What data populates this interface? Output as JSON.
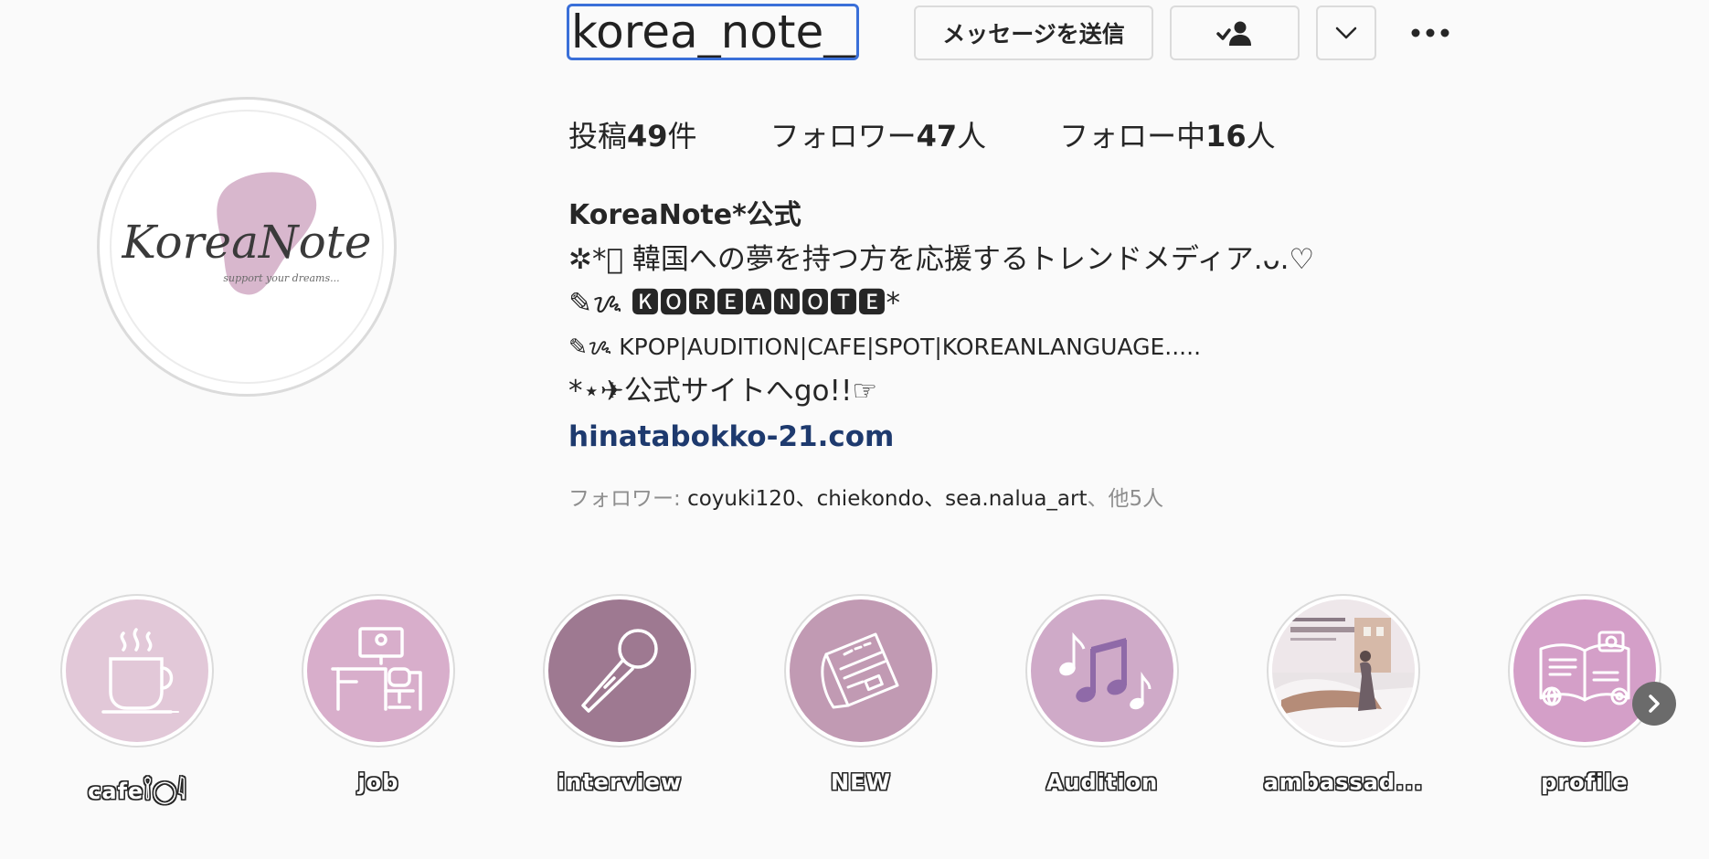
{
  "header": {
    "username": "korea_note__",
    "message_button_label": "メッセージを送信"
  },
  "icons": {
    "following_button": "person-check-icon",
    "dropdown_button": "chevron-down-icon",
    "more_button": "more-horizontal-icon",
    "highlights_next": "chevron-right-icon"
  },
  "avatar": {
    "logo_text": "KoreaNote",
    "logo_tagline": "support your dreams..."
  },
  "stats": [
    {
      "label": "投稿",
      "count": "49",
      "unit": "件"
    },
    {
      "label": "フォロワー",
      "count": "47",
      "unit": "人"
    },
    {
      "label": "フォロー中",
      "count": "16",
      "unit": "人"
    }
  ],
  "bio": {
    "name": "KoreaNote*公式",
    "lines": [
      "✲*ﾟ 韓国への夢を持つ方を応援するトレンドメディア.ᴗ.♡",
      "✎ᝰ 🅺🅾🆁🅴🅰🅽🅾🆃🅴*",
      "✎ᝰ KPOP|AUDITION|CAFE|SPOT|KOREANLANGUAGE.....",
      "*⋆✈公式サイトへgo!!☞"
    ],
    "link": "hinatabokko-21.com"
  },
  "followed_by": {
    "prefix": "フォロワー: ",
    "names": "coyuki120、chiekondo、sea.nalua_art",
    "suffix": "、他5人"
  },
  "highlights": [
    {
      "label": "cafe𓌉◯𓇋",
      "icon": "coffee-cup-icon",
      "bg": "#e2c8d8"
    },
    {
      "label": "job",
      "icon": "desk-icon",
      "bg": "#d8aecb"
    },
    {
      "label": "interview",
      "icon": "microphone-icon",
      "bg": "#9e7991"
    },
    {
      "label": "NEW",
      "icon": "newspaper-icon",
      "bg": "#c19ab3"
    },
    {
      "label": "Audition",
      "icon": "music-notes-icon",
      "bg": "#cfaac8"
    },
    {
      "label": "ambassad...",
      "icon": "photo-icon",
      "bg": "#e9e4e6"
    },
    {
      "label": "profile",
      "icon": "open-book-icon",
      "bg": "#d49fc8"
    }
  ],
  "colors": {
    "username_focus_border": "#3a6fd8",
    "link": "#1e3a6e",
    "accent_pink": "#d8b7cd"
  }
}
